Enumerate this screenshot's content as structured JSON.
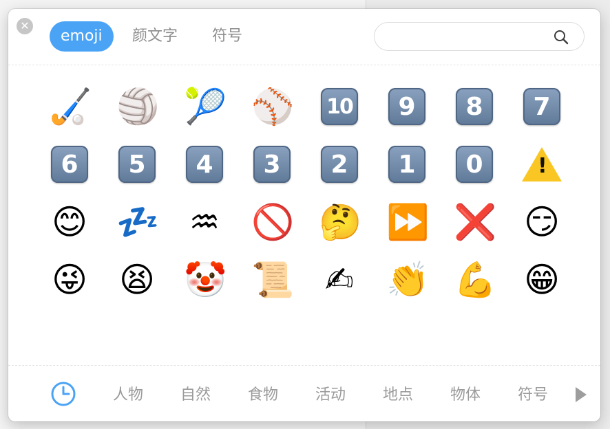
{
  "tabs": {
    "emoji": "emoji",
    "kaomoji": "颜文字",
    "symbols": "符号"
  },
  "search": {
    "placeholder": "",
    "value": "",
    "icon": "search-icon"
  },
  "close": {
    "icon": "close-icon",
    "glyph": "✕"
  },
  "grid": {
    "rows": [
      [
        {
          "name": "field-hockey",
          "glyph": "🏑"
        },
        {
          "name": "volleyball",
          "glyph": "🏐"
        },
        {
          "name": "tennis",
          "glyph": "🎾"
        },
        {
          "name": "baseball",
          "glyph": "⚾"
        },
        {
          "name": "keycap-10",
          "key": "10"
        },
        {
          "name": "keycap-9",
          "key": "9"
        },
        {
          "name": "keycap-8",
          "key": "8"
        },
        {
          "name": "keycap-7",
          "key": "7"
        }
      ],
      [
        {
          "name": "keycap-6",
          "key": "6"
        },
        {
          "name": "keycap-5",
          "key": "5"
        },
        {
          "name": "keycap-4",
          "key": "4"
        },
        {
          "name": "keycap-3",
          "key": "3"
        },
        {
          "name": "keycap-2",
          "key": "2"
        },
        {
          "name": "keycap-1",
          "key": "1"
        },
        {
          "name": "keycap-0",
          "key": "0"
        },
        {
          "name": "warning",
          "warn": "!"
        }
      ],
      [
        {
          "name": "smiling-face-with-smiling-eyes",
          "glyph": "😊"
        },
        {
          "name": "zzz",
          "glyph": "💤"
        },
        {
          "name": "aquarius",
          "glyph": "♒"
        },
        {
          "name": "prohibited",
          "glyph": "🚫"
        },
        {
          "name": "thinking-face",
          "glyph": "🤔"
        },
        {
          "name": "fast-forward",
          "glyph": "⏩"
        },
        {
          "name": "cross-mark",
          "glyph": "❌"
        },
        {
          "name": "smirking-face",
          "glyph": "😏"
        }
      ],
      [
        {
          "name": "winking-face-with-tongue",
          "glyph": "😜"
        },
        {
          "name": "tired-face",
          "glyph": "😫"
        },
        {
          "name": "clown-face",
          "glyph": "🤡"
        },
        {
          "name": "scroll",
          "glyph": "📜"
        },
        {
          "name": "writing-hand",
          "glyph": "✍"
        },
        {
          "name": "clapping-hands",
          "glyph": "👏"
        },
        {
          "name": "flexed-biceps",
          "glyph": "💪"
        },
        {
          "name": "beaming-face",
          "glyph": "😁"
        }
      ]
    ]
  },
  "categories": {
    "recent_icon": "clock-icon",
    "people": "人物",
    "nature": "自然",
    "food": "食物",
    "activity": "活动",
    "places": "地点",
    "objects": "物体",
    "symbols": "符号",
    "next_icon": "play-arrow-icon"
  },
  "colors": {
    "accent": "#4aa3f5",
    "keycap": "#6f88a8",
    "warning": "#f9c623"
  }
}
